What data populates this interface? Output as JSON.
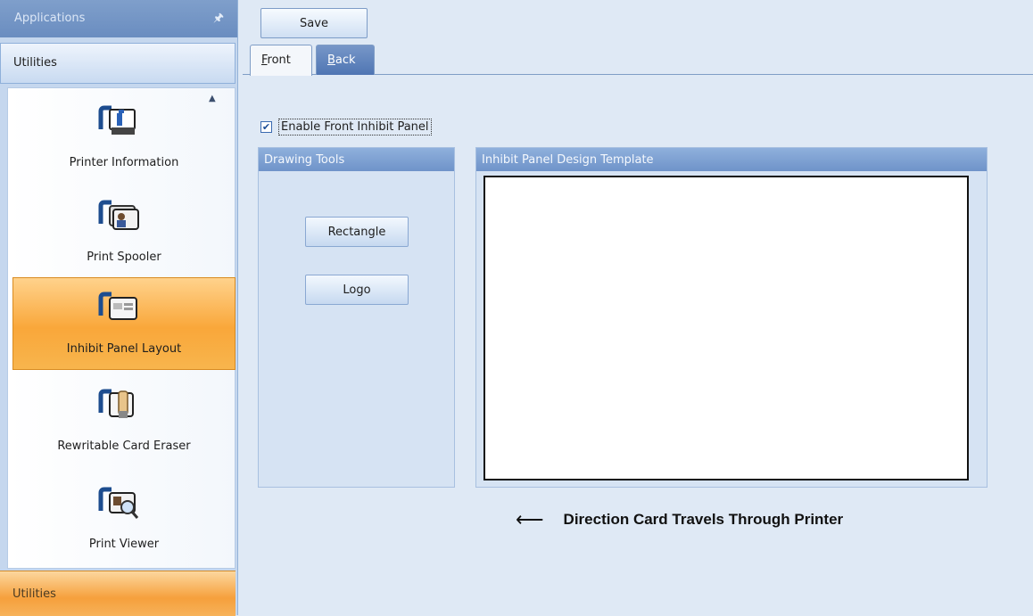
{
  "sidebar": {
    "header_title": "Applications",
    "pin_icon": "pin-icon",
    "group_label": "Utilities",
    "items": [
      {
        "label": "Printer Information",
        "icon": "printer-information-icon"
      },
      {
        "label": "Print Spooler",
        "icon": "print-spooler-icon"
      },
      {
        "label": "Inhibit Panel Layout",
        "icon": "inhibit-panel-layout-icon",
        "selected": true
      },
      {
        "label": "Rewritable Card Eraser",
        "icon": "card-eraser-icon"
      },
      {
        "label": "Print Viewer",
        "icon": "print-viewer-icon"
      }
    ],
    "bottom_group_label": "Utilities"
  },
  "toolbar": {
    "save_label": "Save"
  },
  "tabs": [
    {
      "label": "Front",
      "active": true
    },
    {
      "label": "Back",
      "active": false
    }
  ],
  "front": {
    "enable_checkbox_label": "Enable Front Inhibit Panel",
    "enable_checked": true,
    "drawing_tools": {
      "title": "Drawing Tools",
      "rectangle_label": "Rectangle",
      "logo_label": "Logo"
    },
    "template": {
      "title": "Inhibit Panel Design Template"
    },
    "direction_text": "Direction Card Travels Through Printer"
  },
  "colors": {
    "selected_item": "#f9a73a",
    "panel_header": "#7f9fcb",
    "active_tab_bg": "#f4f7fb",
    "inactive_tab_bg": "#5a7fb9"
  }
}
